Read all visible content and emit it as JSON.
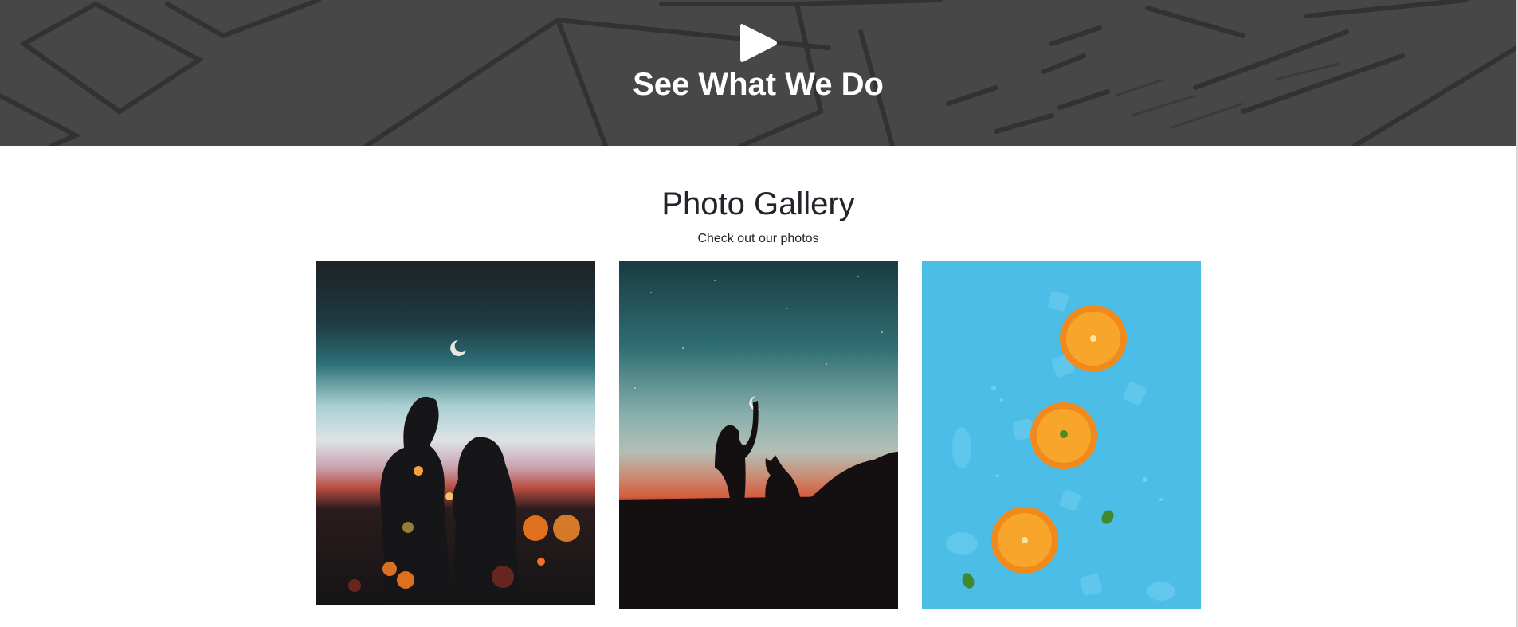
{
  "hero": {
    "title": "See What We Do",
    "play_icon": "play-icon",
    "background_color": "#474747"
  },
  "gallery": {
    "title": "Photo Gallery",
    "subtitle": "Check out our photos",
    "photos": [
      {
        "subject": "couple silhouette at dusk with crescent moon and bokeh lights"
      },
      {
        "subject": "woman and dog silhouette holding crescent moon at sunset"
      },
      {
        "subject": "orange slices and ice cubes on blue background"
      }
    ]
  },
  "colors": {
    "text": "#212529",
    "hero_text": "#ffffff",
    "photo3_bg": "#4bbde6",
    "orange": "#f7931e"
  }
}
